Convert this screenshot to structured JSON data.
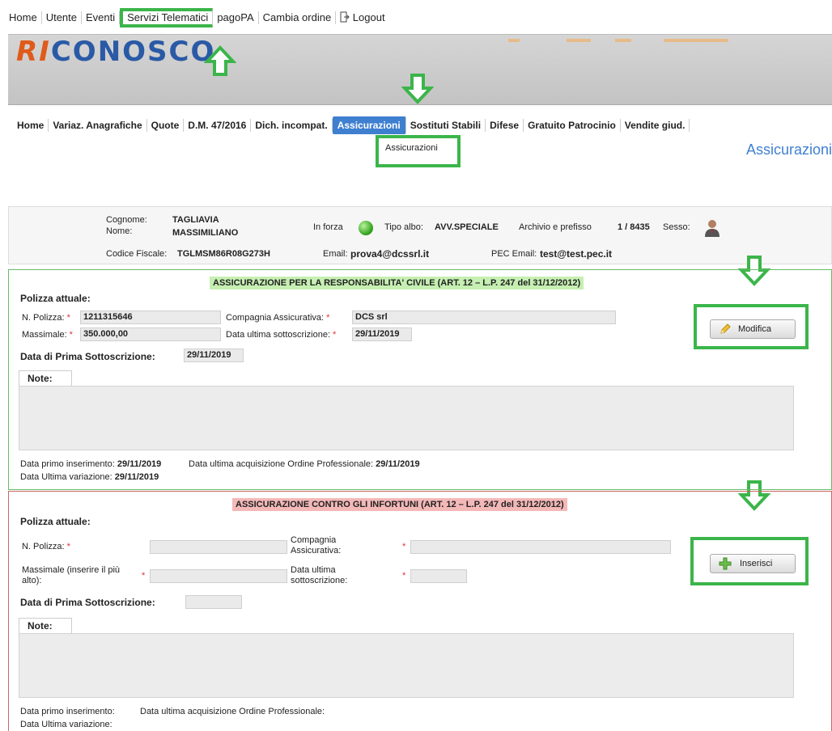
{
  "top_nav": {
    "items": [
      "Home",
      "Utente",
      "Eventi",
      "Servizi Telematici",
      "pagoPA",
      "Cambia ordine",
      "Logout"
    ]
  },
  "logo": {
    "part1": "RI",
    "part2": "CONOSCO"
  },
  "sub_nav": {
    "items": [
      "Home",
      "Variaz. Anagrafiche",
      "Quote",
      "D.M. 47/2016",
      "Dich. incompat.",
      "Assicurazioni",
      "Sostituti Stabili",
      "Difese",
      "Gratuito Patrocinio",
      "Vendite giud."
    ],
    "dropdown_item": "Assicurazioni"
  },
  "page_title": "Assicurazioni",
  "person": {
    "cognome_label": "Cognome:",
    "cognome": "TAGLIAVIA",
    "nome_label": "Nome:",
    "nome": "MASSIMILIANO",
    "in_forza_label": "In forza",
    "tipo_albo_label": "Tipo albo:",
    "tipo_albo": "AVV.SPECIALE",
    "archivio_label": "Archivio e prefisso",
    "archivio": "1 / 8435",
    "sesso_label": "Sesso:",
    "cf_label": "Codice Fiscale:",
    "cf": "TGLMSM86R08G273H",
    "email_label": "Email:",
    "email": "prova4@dcssrl.it",
    "pec_label": "PEC Email:",
    "pec": "test@test.pec.it"
  },
  "rc": {
    "title": "ASSICURAZIONE PER LA RESPONSABILITA' CIVILE (ART. 12 – L.P. 247 del 31/12/2012)",
    "polizza_attuale": "Polizza attuale:",
    "n_polizza_label": "N. Polizza:",
    "n_polizza": "1211315646",
    "compagnia_label": "Compagnia Assicurativa:",
    "compagnia": "DCS srl",
    "massimale_label": "Massimale:",
    "massimale": "350.000,00",
    "data_ultima_label": "Data ultima sottoscrizione:",
    "data_ultima": "29/11/2019",
    "prima_label": "Data di Prima Sottoscrizione:",
    "prima": "29/11/2019",
    "note_label": "Note:",
    "button": "Modifica",
    "primo_ins_label": "Data primo inserimento:",
    "primo_ins": "29/11/2019",
    "ultima_acq_label": "Data ultima acquisizione Ordine Professionale:",
    "ultima_acq": "29/11/2019",
    "ultima_var_label": "Data Ultima variazione:",
    "ultima_var": "29/11/2019"
  },
  "inf": {
    "title": "ASSICURAZIONE CONTRO GLI INFORTUNI (ART. 12 – L.P. 247 del 31/12/2012)",
    "polizza_attuale": "Polizza attuale:",
    "n_polizza_label": "N. Polizza:",
    "compagnia_label_1": "Compagnia",
    "compagnia_label_2": "Assicurativa:",
    "massimale_label_1": "Massimale (inserire il più",
    "massimale_label_2": "alto):",
    "data_ultima_label_1": "Data ultima",
    "data_ultima_label_2": "sottoscrizione:",
    "prima_label": "Data di Prima Sottoscrizione:",
    "note_label": "Note:",
    "button": "Inserisci",
    "primo_ins_label": "Data primo inserimento:",
    "ultima_acq_label": "Data ultima acquisizione Ordine Professionale:",
    "ultima_var_label": "Data Ultima variazione:"
  },
  "colors": {
    "highlight": "#3bb54a",
    "accent": "#3f7fd0"
  }
}
